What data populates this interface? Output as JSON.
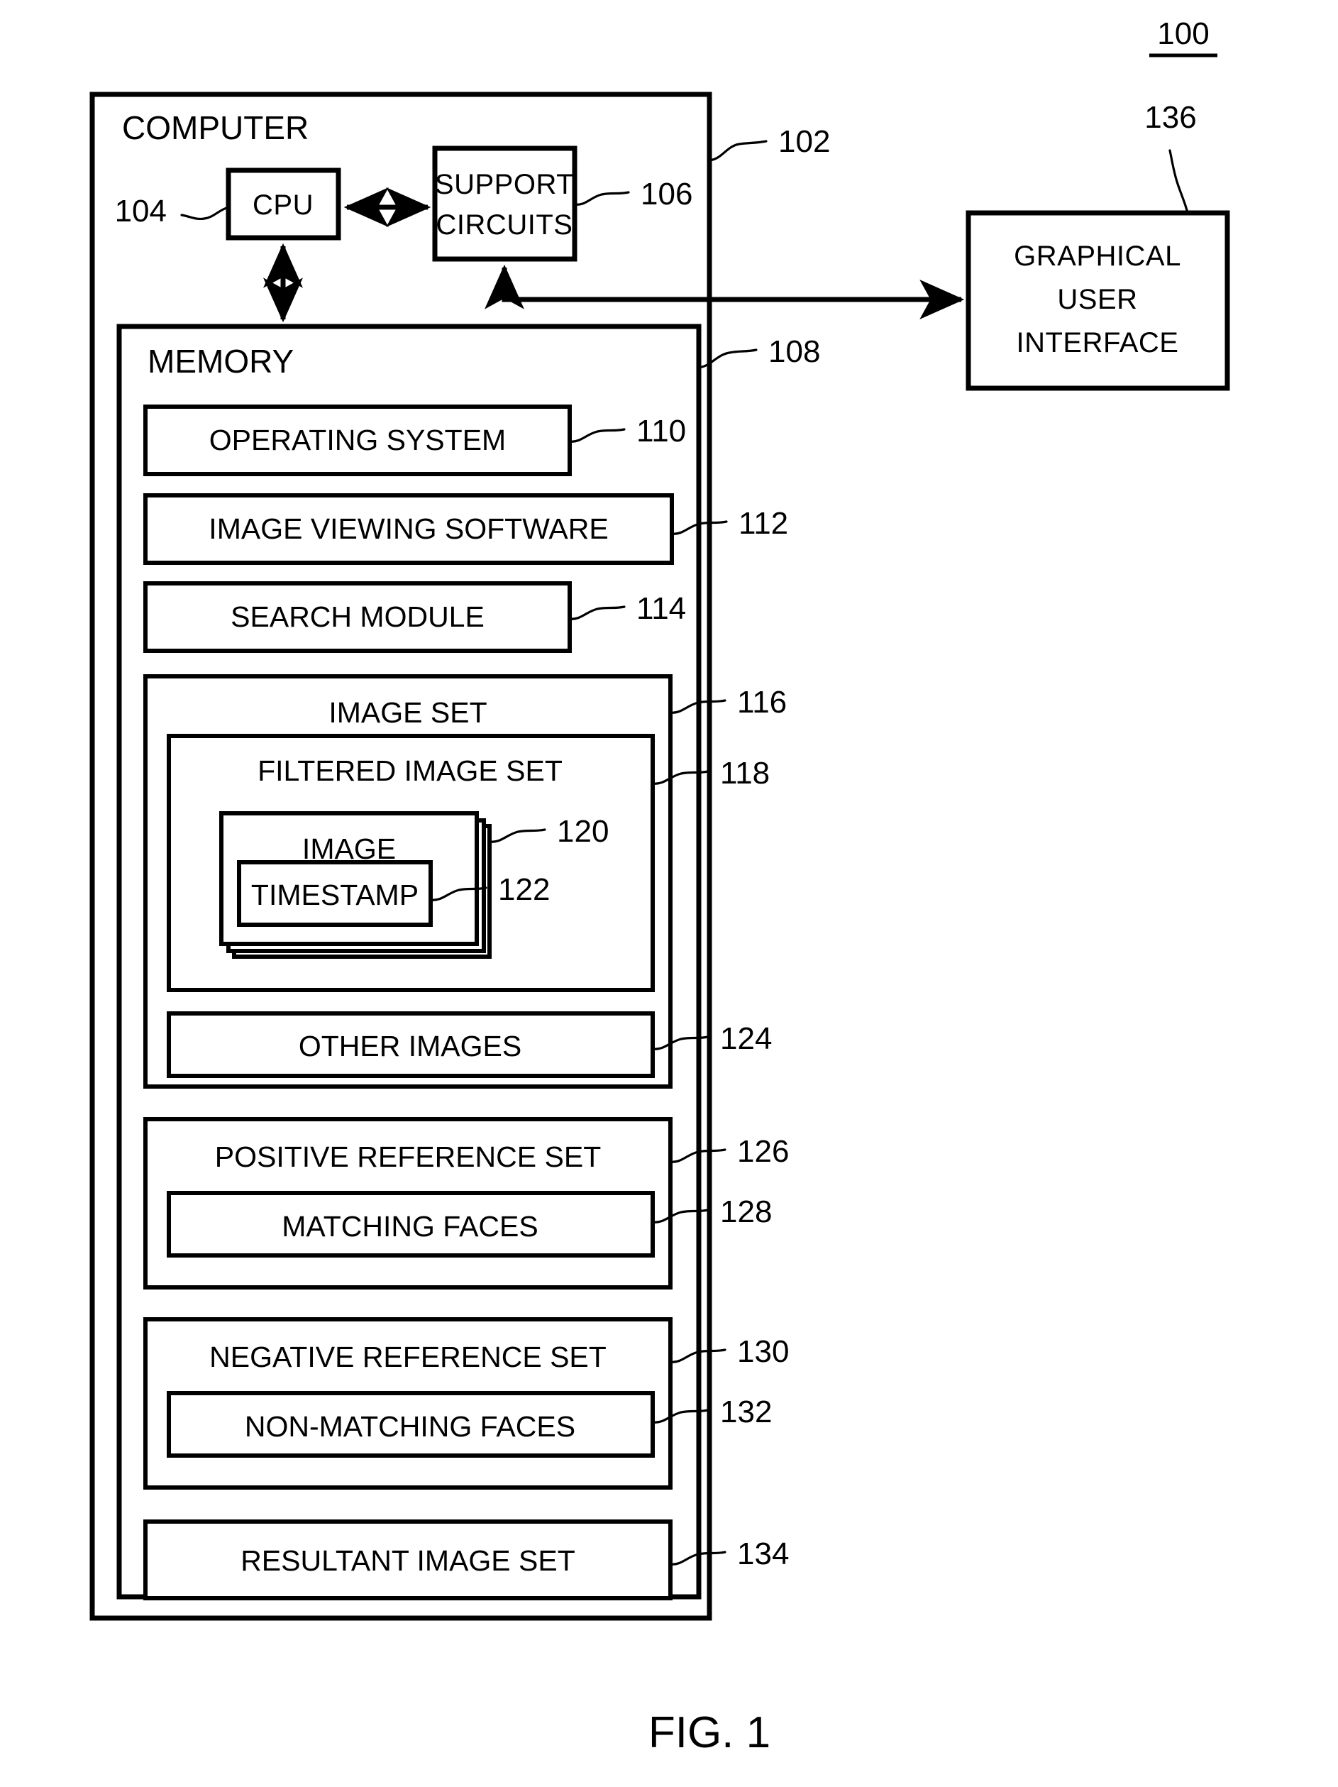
{
  "figure": {
    "number_label": "100",
    "caption": "FIG. 1"
  },
  "computer": {
    "title": "COMPUTER",
    "ref": "102"
  },
  "cpu": {
    "label": "CPU",
    "ref": "104"
  },
  "support_circuits": {
    "label_line1": "SUPPORT",
    "label_line2": "CIRCUITS",
    "ref": "106"
  },
  "gui": {
    "label_line1": "GRAPHICAL",
    "label_line2": "USER",
    "label_line3": "INTERFACE",
    "ref": "136"
  },
  "memory": {
    "title": "MEMORY",
    "ref": "108",
    "items": [
      {
        "label": "OPERATING SYSTEM",
        "ref": "110"
      },
      {
        "label": "IMAGE VIEWING SOFTWARE",
        "ref": "112"
      },
      {
        "label": "SEARCH MODULE",
        "ref": "114"
      }
    ],
    "image_set": {
      "label": "IMAGE SET",
      "ref": "116",
      "filtered_image_set": {
        "label": "FILTERED IMAGE SET",
        "ref": "118",
        "image": {
          "label": "IMAGE",
          "ref": "120"
        },
        "timestamp": {
          "label": "TIMESTAMP",
          "ref": "122"
        }
      },
      "other_images": {
        "label": "OTHER IMAGES",
        "ref": "124"
      }
    },
    "positive_reference_set": {
      "label": "POSITIVE REFERENCE SET",
      "ref": "126",
      "matching_faces": {
        "label": "MATCHING FACES",
        "ref": "128"
      }
    },
    "negative_reference_set": {
      "label": "NEGATIVE REFERENCE SET",
      "ref": "130",
      "non_matching_faces": {
        "label": "NON-MATCHING FACES",
        "ref": "132"
      }
    },
    "resultant_image_set": {
      "label": "RESULTANT IMAGE SET",
      "ref": "134"
    }
  }
}
